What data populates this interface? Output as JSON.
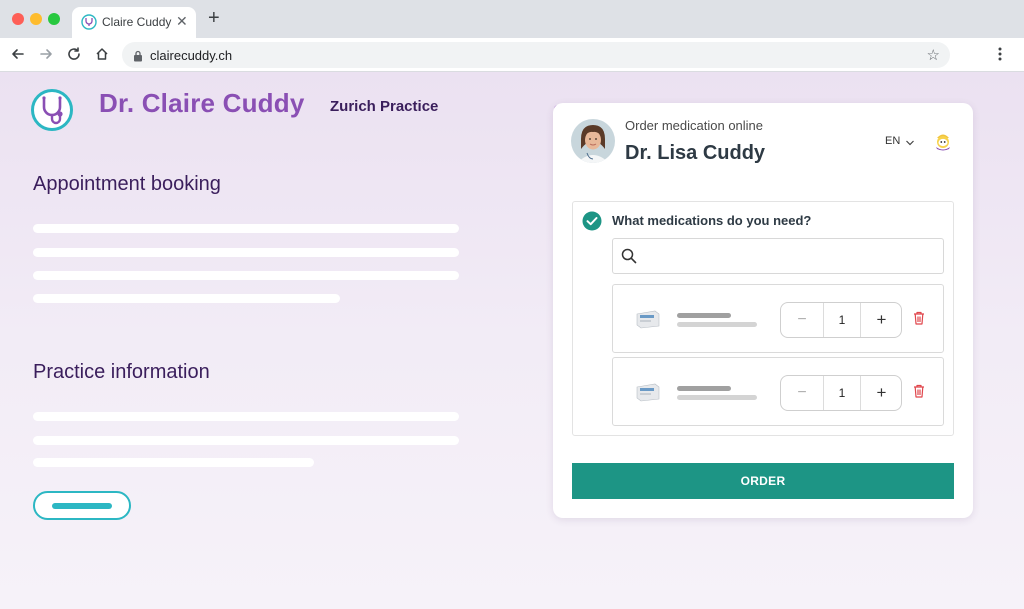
{
  "browser": {
    "tab_title": "Claire Cuddy",
    "url": "clairecuddy.ch"
  },
  "header": {
    "brand": "Dr. Claire Cuddy",
    "practice": "Zurich Practice"
  },
  "main": {
    "section1_title": "Appointment booking",
    "section2_title": "Practice information"
  },
  "widget": {
    "subtitle": "Order medication online",
    "doctor_name": "Dr. Lisa Cuddy",
    "language": "EN",
    "question": "What medications do you need?",
    "search_placeholder": "",
    "medications": [
      {
        "quantity": "1",
        "minus": "−",
        "plus": "+"
      },
      {
        "quantity": "1",
        "minus": "−",
        "plus": "+"
      }
    ],
    "order_label": "ORDER"
  },
  "colors": {
    "brand_purple": "#8a4fb4",
    "teal": "#2cb7c3",
    "order_green": "#1d9585",
    "delete_red": "#e0454b"
  }
}
